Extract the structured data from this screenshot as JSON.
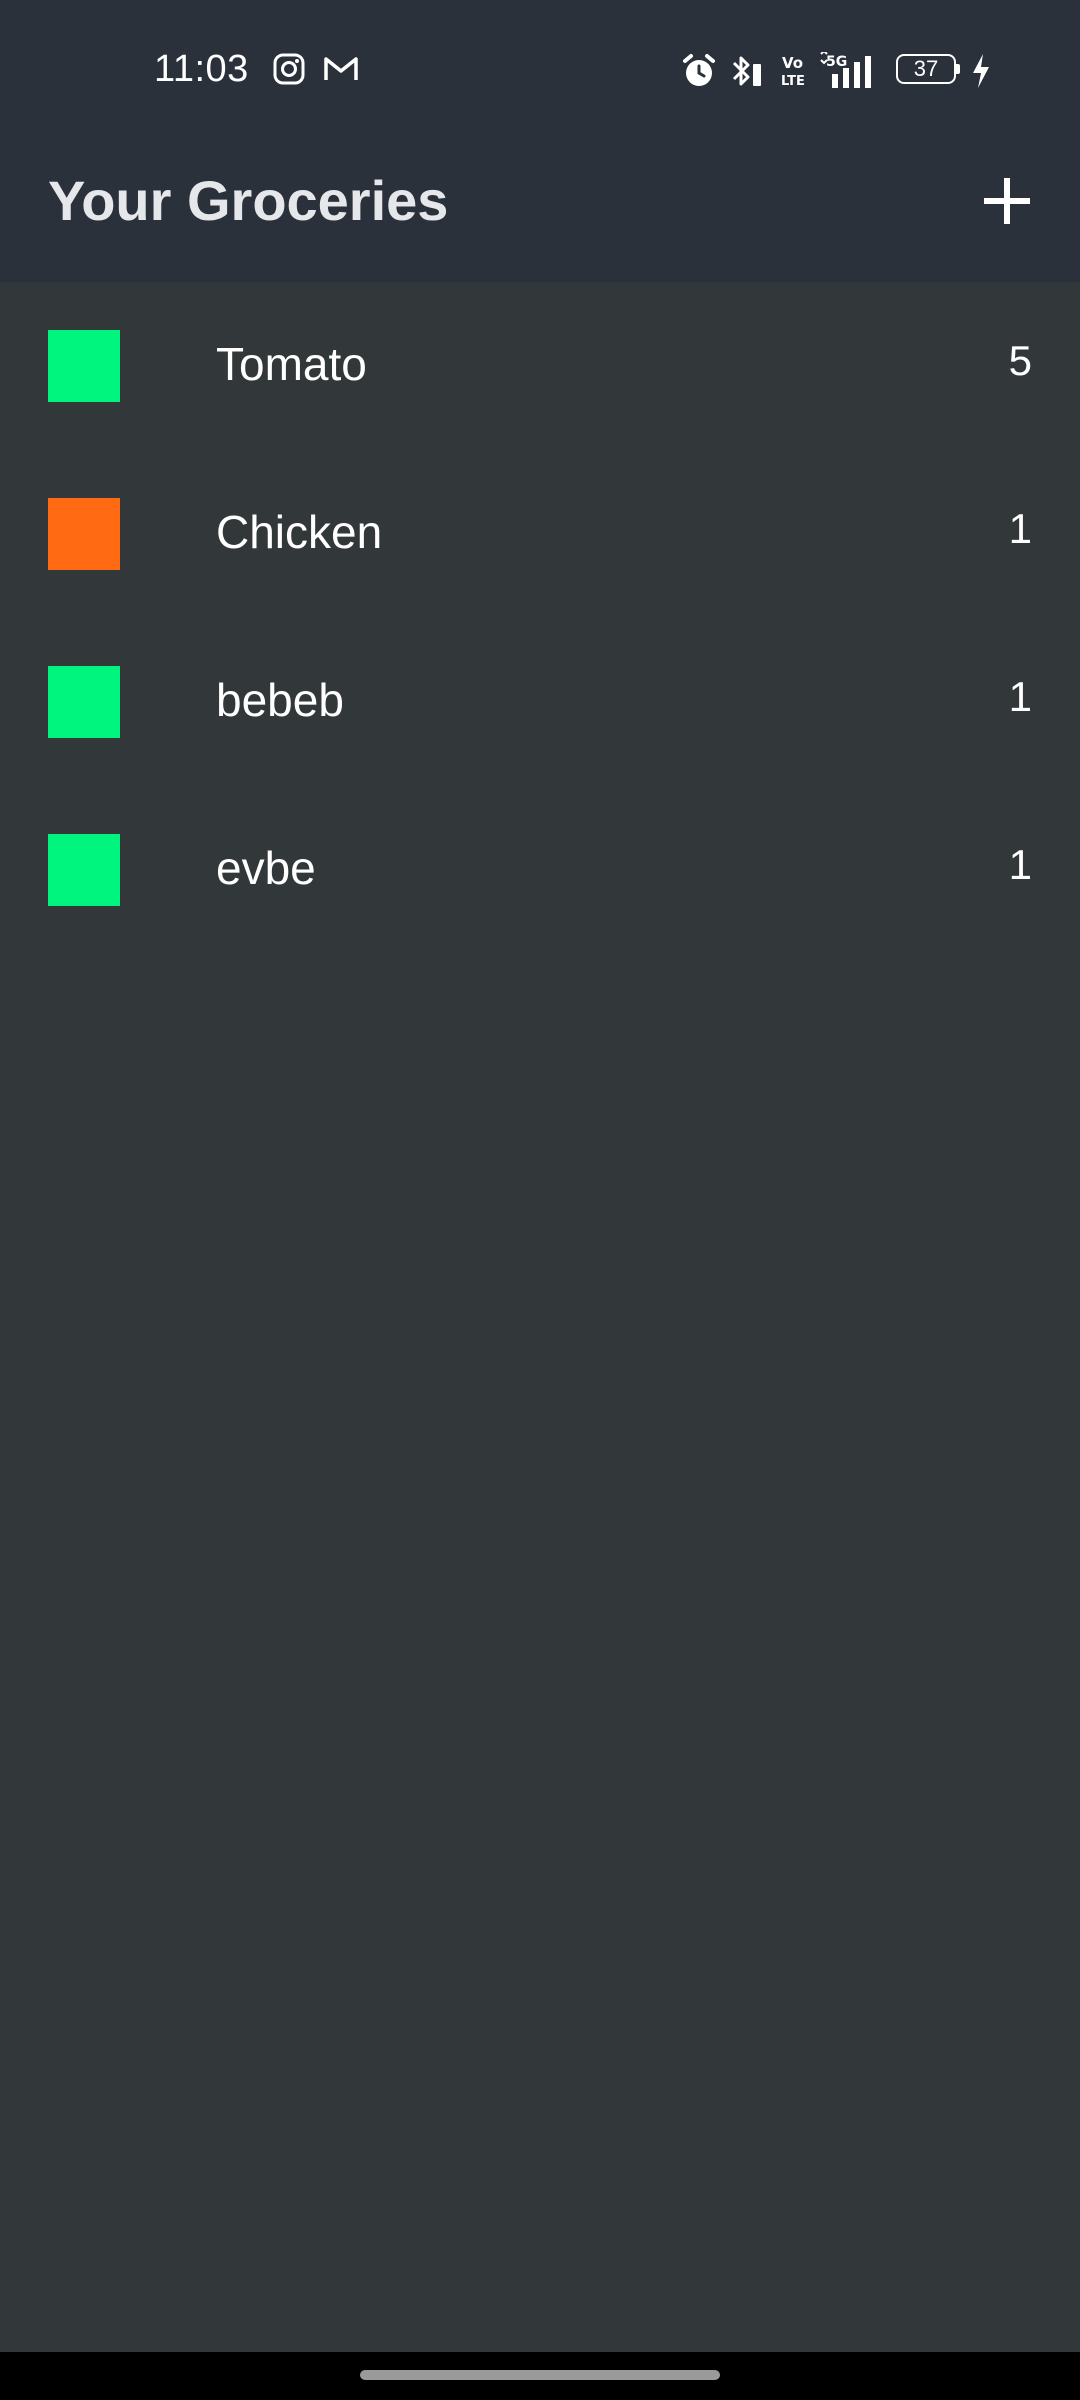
{
  "status_bar": {
    "time": "11:03",
    "battery_level": "37",
    "icons_left": [
      "instagram-icon",
      "gmail-icon"
    ],
    "icons_right": [
      "alarm-icon",
      "bluetooth-icon",
      "volte-icon",
      "5g-signal-icon",
      "battery-icon",
      "charging-icon"
    ]
  },
  "app_bar": {
    "title": "Your Groceries",
    "add_icon": "plus-icon"
  },
  "groceries": [
    {
      "name": "Tomato",
      "quantity": "5",
      "color": "#00f57f"
    },
    {
      "name": "Chicken",
      "quantity": "1",
      "color": "#ff6a12"
    },
    {
      "name": "bebeb",
      "quantity": "1",
      "color": "#00f57f"
    },
    {
      "name": "evbe",
      "quantity": "1",
      "color": "#00f57f"
    }
  ],
  "colors": {
    "background": "#323839",
    "app_bar": "#2a313a",
    "title_text": "#e6e7ea"
  }
}
